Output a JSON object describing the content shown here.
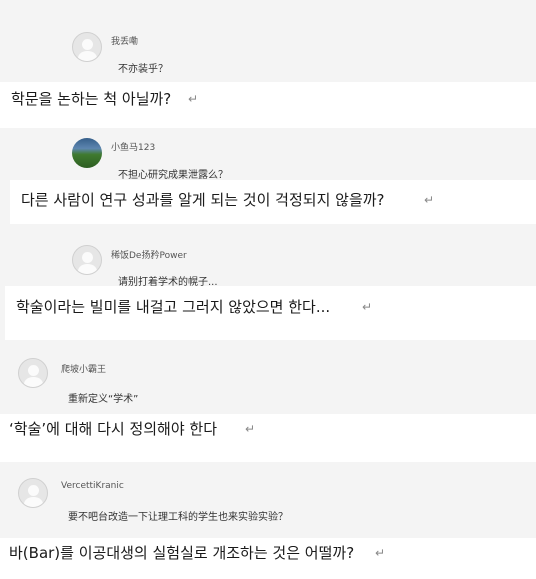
{
  "comments": [
    {
      "username": "我丢嘞",
      "comment": "不亦装乎？",
      "translation": "학문을 논하는 척 아닐까?",
      "mark": "↵"
    },
    {
      "username": "小鱼马123",
      "comment": "不担心研究成果泄露么？",
      "translation": "다른 사람이 연구 성과를 알게 되는 것이 걱정되지 않을까?",
      "mark": "↵"
    },
    {
      "username": "稀饭De扬矜Power",
      "comment": "请别打着学术的幌子...",
      "translation": "학술이라는 빌미를 내걸고 그러지 않았으면 한다...",
      "mark": "↵"
    },
    {
      "username": "爬坡小霸王",
      "comment": "重新定义“学术”",
      "translation": "‘학술’에 대해 다시 정의해야 한다",
      "mark": "↵"
    },
    {
      "username": "VercettiKranic",
      "comment": "要不吧台改造一下让理工科的学生也来实验实验？",
      "translation": "바(Bar)를 이공대생의 실험실로 개조하는 것은 어떨까?",
      "mark": "↵"
    }
  ]
}
